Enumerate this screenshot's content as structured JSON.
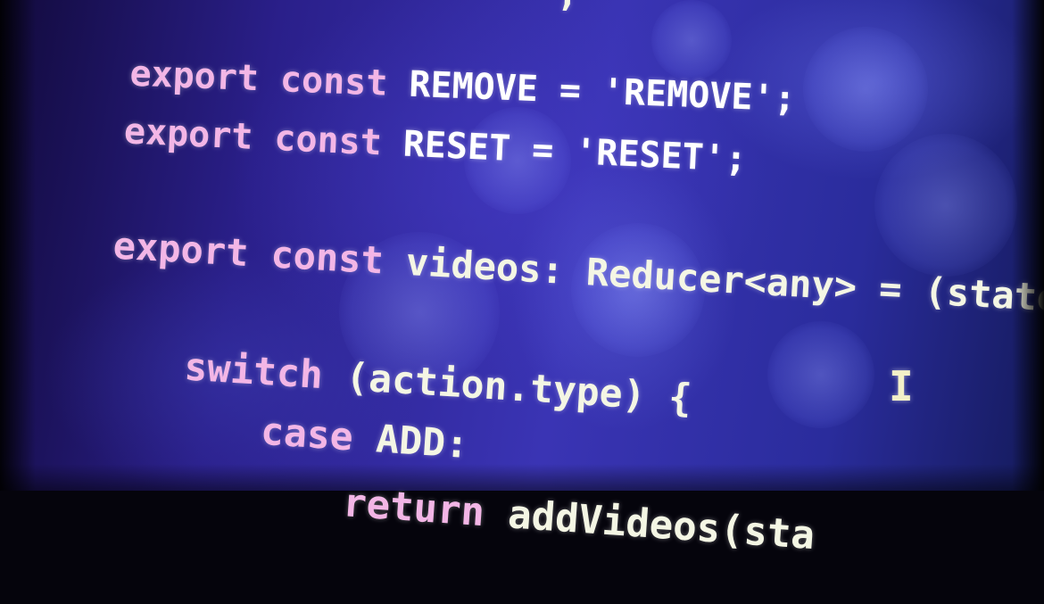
{
  "code_lines": [
    {
      "keyword": "export const",
      "rest": " REMOVE = 'REMOVE';"
    },
    {
      "keyword": "export const",
      "rest": " RESET = 'RESET';"
    },
    {
      "keyword": "export const",
      "rest": " videos: Reducer<any> = (state"
    },
    {
      "keyword": "switch",
      "rest": " (action.type) {"
    },
    {
      "keyword": "case",
      "rest": " ADD:"
    },
    {
      "keyword": "return",
      "rest": " addVideos(sta"
    }
  ],
  "partial_top": "',",
  "cursor_glyph": "I",
  "colors": {
    "keyword": "#f3b6e6",
    "text": "#f4f6e4",
    "background": "#2a1f8a"
  }
}
